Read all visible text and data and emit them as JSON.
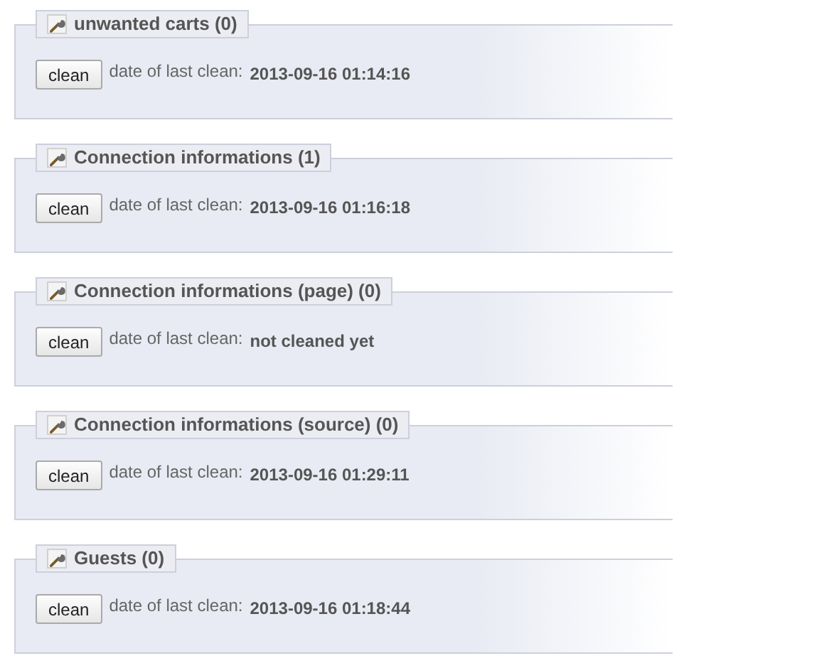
{
  "sections": [
    {
      "title": "unwanted carts (0)",
      "button": "clean",
      "label": "date of last clean:",
      "value": "2013-09-16 01:14:16"
    },
    {
      "title": "Connection informations (1)",
      "button": "clean",
      "label": "date of last clean:",
      "value": "2013-09-16 01:16:18"
    },
    {
      "title": "Connection informations (page) (0)",
      "button": "clean",
      "label": "date of last clean:",
      "value": "not cleaned yet"
    },
    {
      "title": "Connection informations (source) (0)",
      "button": "clean",
      "label": "date of last clean:",
      "value": "2013-09-16 01:29:11"
    },
    {
      "title": "Guests (0)",
      "button": "clean",
      "label": "date of last clean:",
      "value": "2013-09-16 01:18:44"
    }
  ]
}
